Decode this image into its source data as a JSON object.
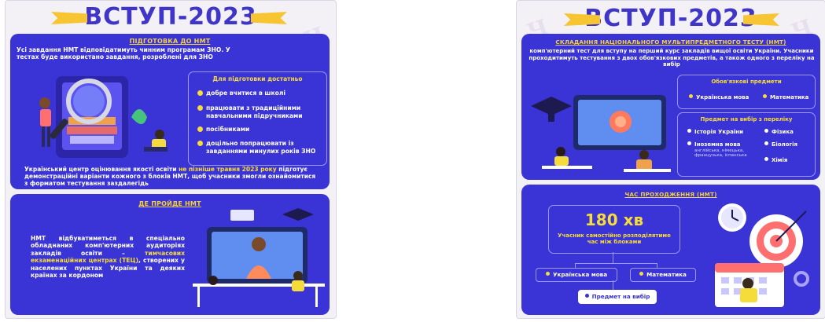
{
  "left": {
    "title": "ВСТУП-2023",
    "prep": {
      "heading": "ПІДГОТОВКА ДО НМТ",
      "intro": "Усі завдання НМТ відповідатимуть чинним програмам ЗНО. У тестах буде використано завдання, розроблені для ЗНО",
      "box_heading": "Для підготовки достатньо",
      "items": [
        "добре вчитися в школі",
        "працювати з традиційними навчальними підручниками",
        "посібниками",
        "доцільно попрацювати із завданнями минулих років ЗНО"
      ],
      "note_before": "Український центр оцінювання якості освіти ",
      "note_highlight": "не пізніше травня 2023 року",
      "note_after": " підготує демонстраційні варіанти кожного з блоків НМТ, щоб учасники змогли ознайомитися з форматом тестування заздалегідь"
    },
    "where": {
      "heading": "ДЕ ПРОЙДЕ НМТ",
      "text_before": "НМТ відбуватиметься в спеціально обладнаних комп'ютерних аудиторіях закладів освіти – ",
      "text_highlight": "тимчасових екзаменаційних центрах (ТЕЦ)",
      "text_after": ", створених у населених пунктах України та деяких країнах за кордоном"
    }
  },
  "right": {
    "title": "ВСТУП-2023",
    "composition": {
      "heading": "СКЛАДАННЯ НАЦІОНАЛЬНОГО МУЛЬТИПРЕДМЕТНОГО ТЕСТУ (НМТ)",
      "intro": "комп'ютерний тест для вступу на перший курс закладів вищої освіти України. Учасники проходитимуть тестування з двох обов'язкових предметів, а також одного з переліку на вибір",
      "mandatory_heading": "Обов'язкові предмети",
      "mandatory": [
        "Українська мова",
        "Математика"
      ],
      "elective_heading": "Предмет на вибір з переліку",
      "elective_left": [
        "Історія України",
        "Іноземна мова"
      ],
      "elective_languages": "англійська, німецька, французька, іспанська",
      "elective_right": [
        "Фізика",
        "Біологія",
        "Хімія"
      ]
    },
    "time": {
      "heading": "ЧАС ПРОХОДЖЕННЯ (НМТ)",
      "minutes": "180 хв",
      "note": "Учасник самостійно розподілятиме час між блоками",
      "blocks": [
        "Українська мова",
        "Математика",
        "Предмет на вибір"
      ]
    }
  },
  "colors": {
    "panel": "#3a33d6",
    "title": "#3f35c8",
    "accent": "#f6dc3b",
    "background": "#f3f1f6"
  },
  "icons": [
    "ribbon-icon",
    "magnifier-icon",
    "laptop-student-icon",
    "graduation-cap-icon",
    "monitor-teacher-icon",
    "target-icon",
    "calendar-icon",
    "clock-icon"
  ]
}
